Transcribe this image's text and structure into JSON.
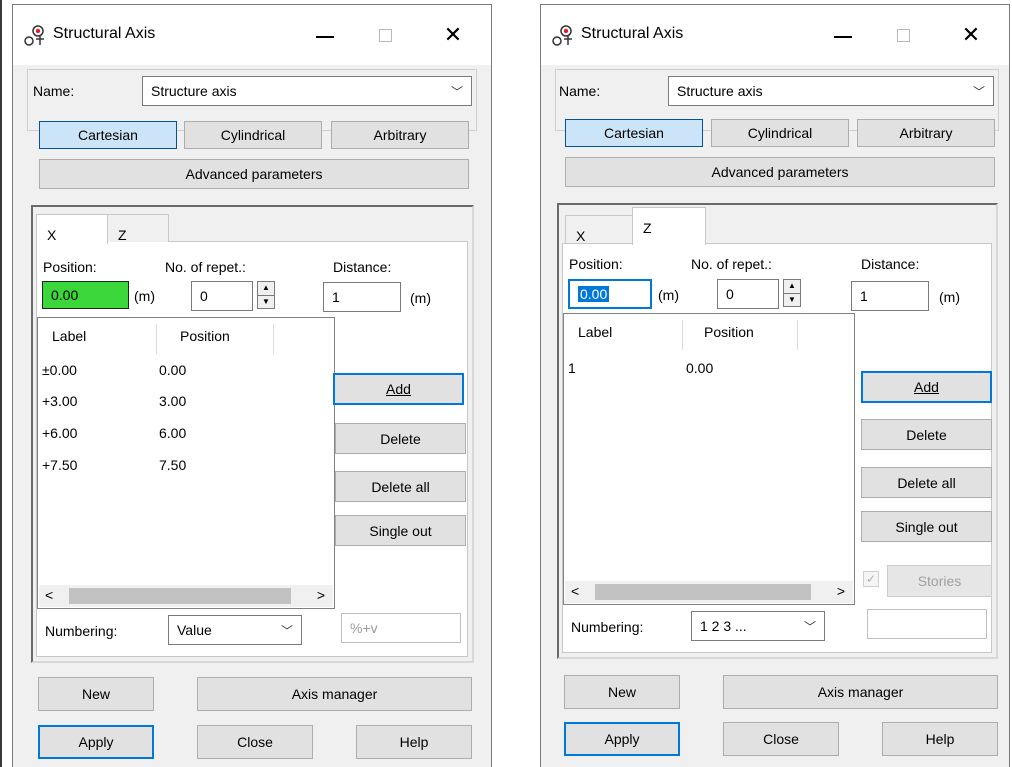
{
  "left": {
    "title": "Structural Axis",
    "name_label": "Name:",
    "name_value": "Structure axis",
    "coord_buttons": [
      "Cartesian",
      "Cylindrical",
      "Arbitrary"
    ],
    "advanced": "Advanced parameters",
    "tabs": [
      "X",
      "Z"
    ],
    "active_tab": "X",
    "position_label": "Position:",
    "position_value": "0.00",
    "unit": "(m)",
    "repet_label": "No. of repet.:",
    "repet_value": "0",
    "distance_label": "Distance:",
    "distance_value": "1",
    "distance_unit": "(m)",
    "list_headers": [
      "Label",
      "Position"
    ],
    "rows": [
      {
        "label": "±0.00",
        "position": "0.00"
      },
      {
        "label": "+3.00",
        "position": "3.00"
      },
      {
        "label": "+6.00",
        "position": "6.00"
      },
      {
        "label": "+7.50",
        "position": "7.50"
      }
    ],
    "buttons": [
      "Add",
      "Delete",
      "Delete all",
      "Single out"
    ],
    "numbering_label": "Numbering:",
    "numbering_value": "Value",
    "format_placeholder": "%+v",
    "bottom": {
      "new": "New",
      "axis_manager": "Axis manager",
      "apply": "Apply",
      "close": "Close",
      "help": "Help"
    }
  },
  "right": {
    "title": "Structural Axis",
    "name_label": "Name:",
    "name_value": "Structure axis",
    "coord_buttons": [
      "Cartesian",
      "Cylindrical",
      "Arbitrary"
    ],
    "advanced": "Advanced parameters",
    "tabs": [
      "X",
      "Z"
    ],
    "active_tab": "Z",
    "position_label": "Position:",
    "position_value": "0.00",
    "unit": "(m)",
    "repet_label": "No. of repet.:",
    "repet_value": "0",
    "distance_label": "Distance:",
    "distance_value": "1",
    "distance_unit": "(m)",
    "list_headers": [
      "Label",
      "Position"
    ],
    "rows": [
      {
        "label": "1",
        "position": "0.00"
      }
    ],
    "buttons": [
      "Add",
      "Delete",
      "Delete all",
      "Single out"
    ],
    "stories": "Stories",
    "numbering_label": "Numbering:",
    "numbering_value": "1 2 3 ...",
    "format_value": "",
    "bottom": {
      "new": "New",
      "axis_manager": "Axis manager",
      "apply": "Apply",
      "close": "Close",
      "help": "Help"
    }
  }
}
